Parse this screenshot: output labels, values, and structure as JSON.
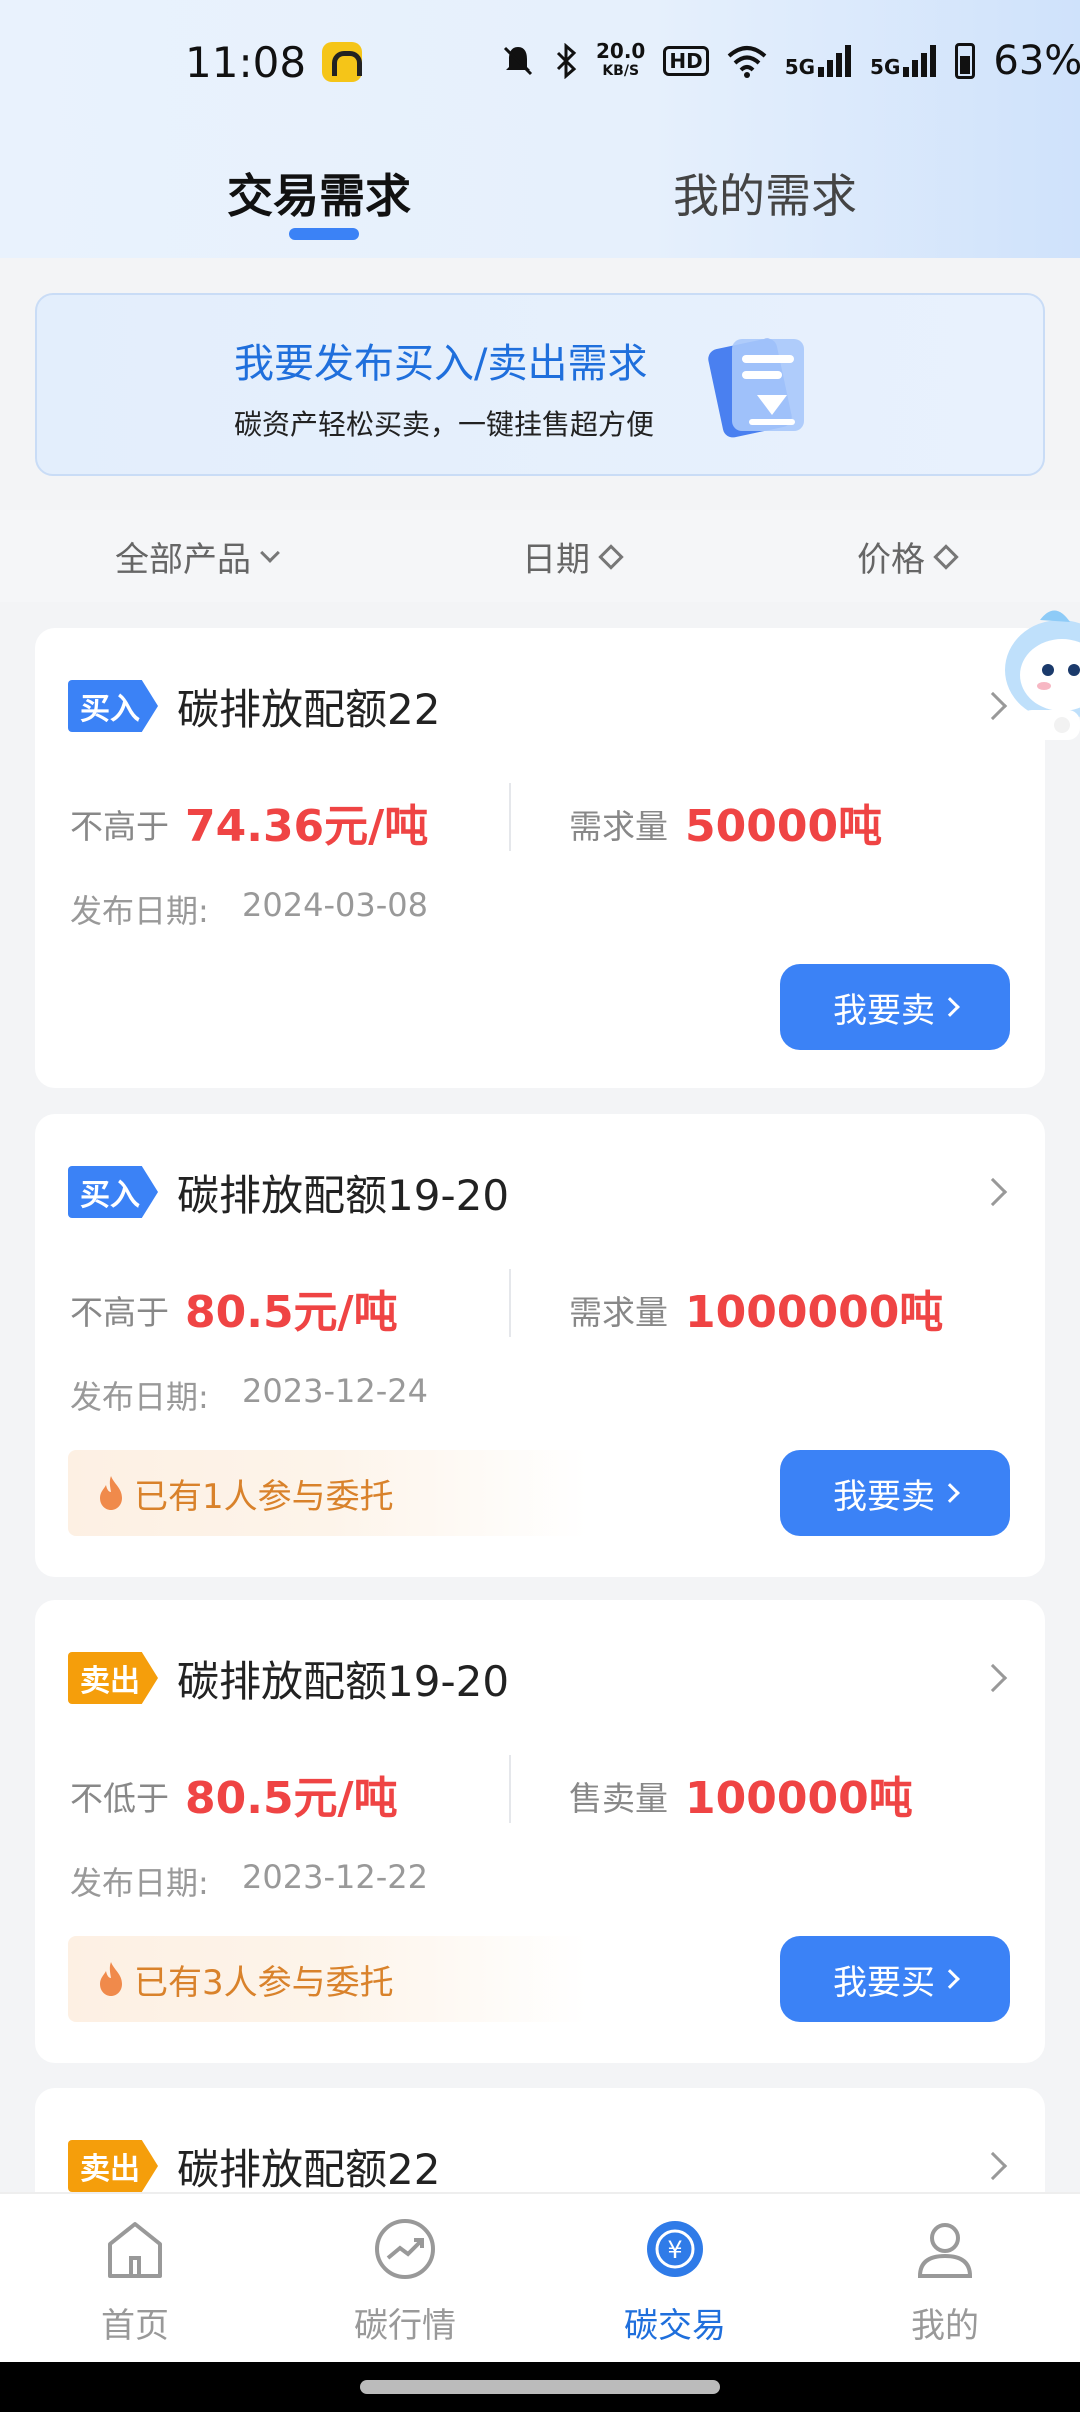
{
  "status_bar": {
    "time": "11:08",
    "net_speed": "20.0",
    "net_unit": "KB/S",
    "hd": "HD",
    "signal1": "5G",
    "signal2": "5G",
    "battery": "63%"
  },
  "tabs": [
    {
      "label": "交易需求",
      "active": true
    },
    {
      "label": "我的需求",
      "active": false
    }
  ],
  "banner": {
    "title": "我要发布买入/卖出需求",
    "subtitle": "碳资产轻松买卖，一键挂售超方便"
  },
  "filters": {
    "product": "全部产品",
    "date": "日期",
    "price": "价格"
  },
  "cards": [
    {
      "tag": "买入",
      "title": "碳排放配额22",
      "price_label": "不高于",
      "price": "74.36元/吨",
      "qty_label": "需求量",
      "qty": "50000吨",
      "date_label": "发布日期:",
      "date": "2024-03-08",
      "participants": "",
      "button": "我要卖"
    },
    {
      "tag": "买入",
      "title": "碳排放配额19-20",
      "price_label": "不高于",
      "price": "80.5元/吨",
      "qty_label": "需求量",
      "qty": "1000000吨",
      "date_label": "发布日期:",
      "date": "2023-12-24",
      "participants": "已有1人参与委托",
      "button": "我要卖"
    },
    {
      "tag": "卖出",
      "title": "碳排放配额19-20",
      "price_label": "不低于",
      "price": "80.5元/吨",
      "qty_label": "售卖量",
      "qty": "100000吨",
      "date_label": "发布日期:",
      "date": "2023-12-22",
      "participants": "已有3人参与委托",
      "button": "我要买"
    },
    {
      "tag": "卖出",
      "title": "碳排放配额22"
    }
  ],
  "bottom_nav": [
    {
      "label": "首页",
      "icon": "home-icon"
    },
    {
      "label": "碳行情",
      "icon": "market-trend-icon"
    },
    {
      "label": "碳交易",
      "icon": "yuan-exchange-icon"
    },
    {
      "label": "我的",
      "icon": "user-icon"
    }
  ],
  "colors": {
    "accent": "#3b82f6",
    "price": "#ef4444",
    "sell_tag": "#f59e0b",
    "participants": "#d9822b"
  }
}
